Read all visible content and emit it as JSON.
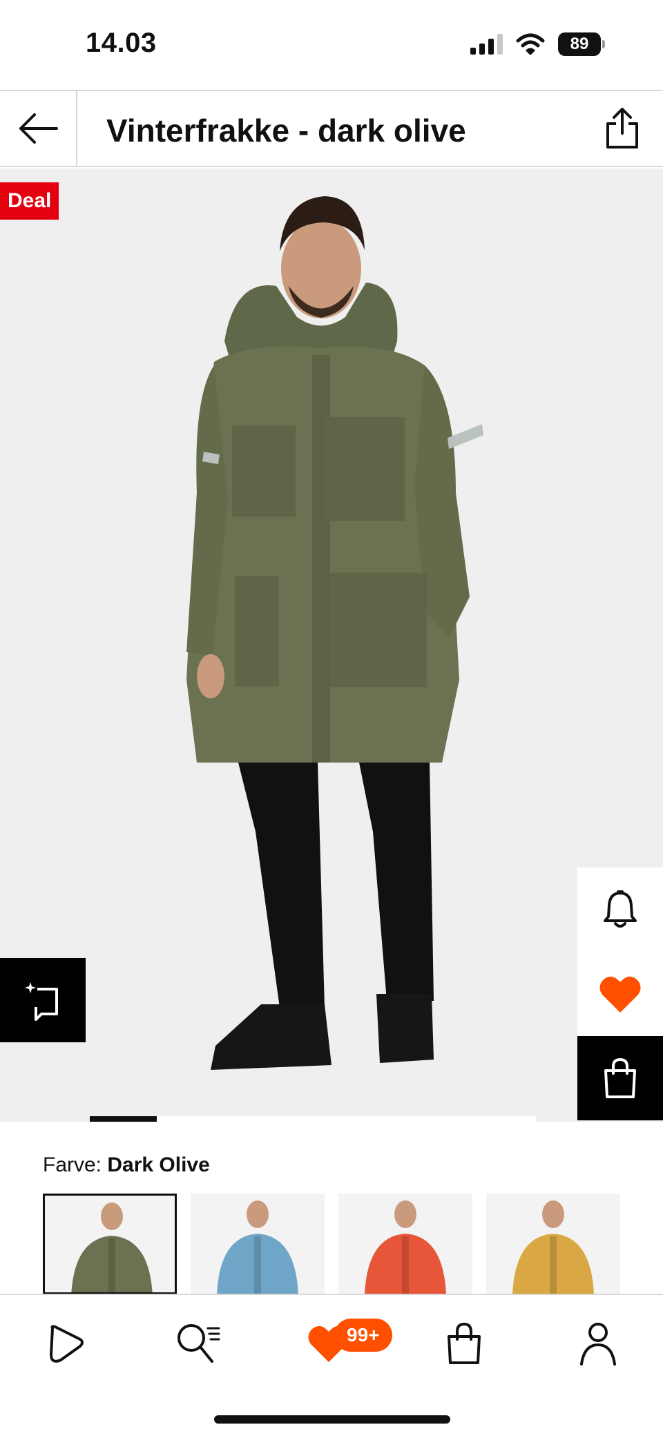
{
  "status_bar": {
    "time": "14.03",
    "battery": "89"
  },
  "header": {
    "title": "Vinterfrakke - dark olive",
    "back_icon": "arrow-left-icon",
    "share_icon": "share-icon"
  },
  "hero": {
    "badge": "Deal",
    "image_progress": 0.15,
    "actions": {
      "notify_icon": "bell-icon",
      "favorite_icon": "heart-icon",
      "cart_icon": "shopping-bag-icon",
      "visual_search_icon": "visual-search-icon"
    }
  },
  "color": {
    "label": "Farve:",
    "selected": "Dark Olive",
    "swatches": [
      {
        "name": "dark olive",
        "color": "#6b7251",
        "selected": true
      },
      {
        "name": "blue",
        "color": "#6fa6c8",
        "selected": false
      },
      {
        "name": "orange",
        "color": "#e8563a",
        "selected": false
      },
      {
        "name": "mustard",
        "color": "#d9a844",
        "selected": false
      }
    ]
  },
  "bottom_nav": {
    "items": [
      "home-icon",
      "search-icon",
      "wishlist-icon",
      "bag-icon",
      "account-icon"
    ],
    "wishlist_badge": "99+"
  },
  "colors": {
    "accent": "#e3000f",
    "wishlist": "#ff4f00"
  }
}
